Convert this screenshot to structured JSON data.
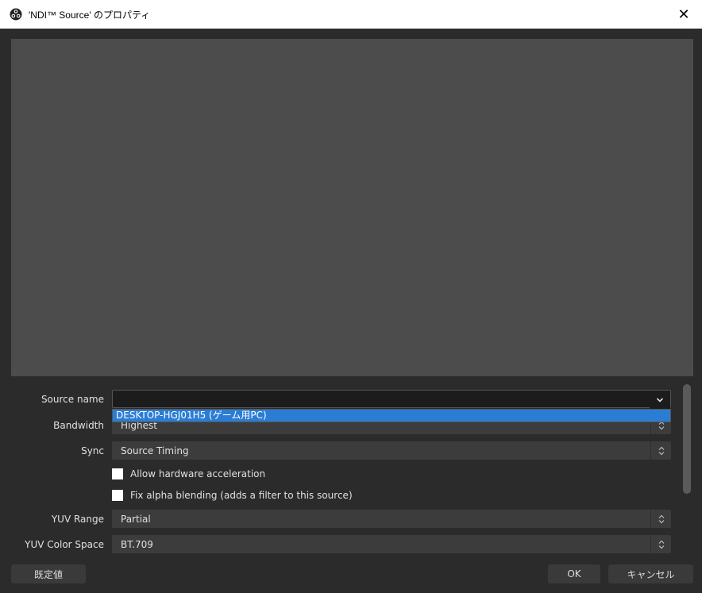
{
  "window": {
    "title": "'NDI™ Source' のプロパティ",
    "close_glyph": "✕"
  },
  "icons": {
    "app": "obs-logo-icon",
    "close": "close-icon",
    "dropdown": "chevron-down-icon",
    "spinner": "updown-spinner-icon"
  },
  "form": {
    "source_name": {
      "label": "Source name",
      "value": "",
      "options": [
        "DESKTOP-HGJ01H5 (ゲーム用PC)"
      ],
      "highlighted_option": "DESKTOP-HGJ01H5 (ゲーム用PC)"
    },
    "bandwidth": {
      "label": "Bandwidth",
      "value": "Highest"
    },
    "sync": {
      "label": "Sync",
      "value": "Source Timing"
    },
    "allow_hw_accel": {
      "label": "Allow hardware acceleration",
      "checked": false
    },
    "fix_alpha": {
      "label": "Fix alpha blending (adds a filter to this source)",
      "checked": false
    },
    "yuv_range": {
      "label": "YUV Range",
      "value": "Partial"
    },
    "yuv_color_space": {
      "label": "YUV Color Space",
      "value": "BT.709"
    }
  },
  "buttons": {
    "defaults": "既定値",
    "ok": "OK",
    "cancel": "キャンセル"
  },
  "colors": {
    "background": "#2b2b2b",
    "preview": "#4c4c4c",
    "selection": "#2b7dd4"
  }
}
